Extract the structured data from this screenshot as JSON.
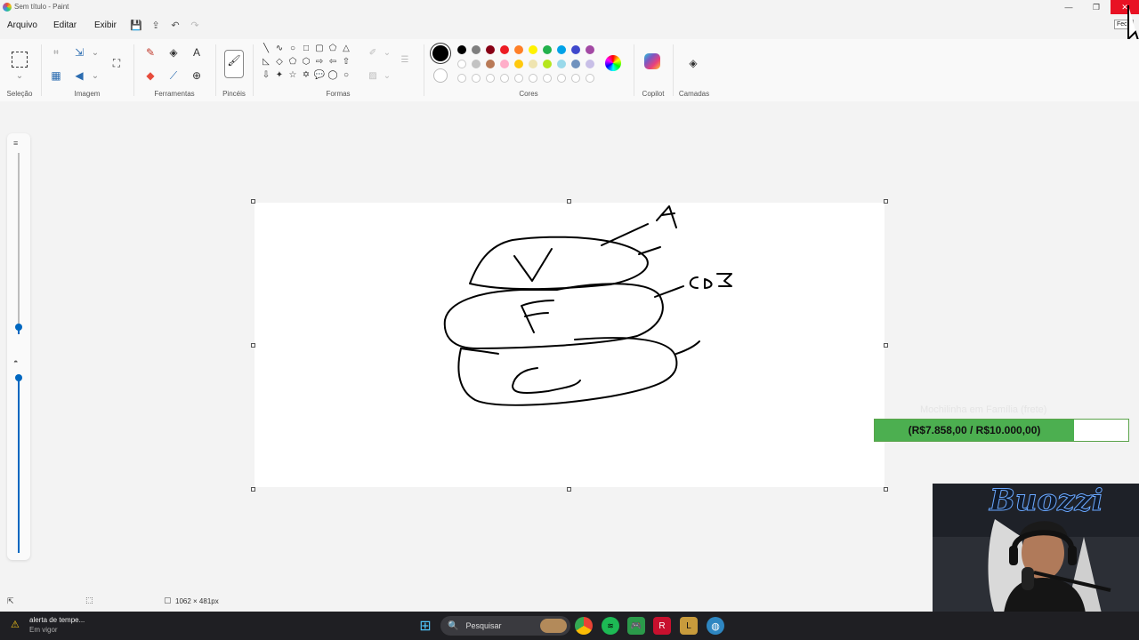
{
  "window": {
    "title": "Sem título - Paint",
    "minimize_icon": "minimize-icon",
    "restore_icon": "restore-icon",
    "close_icon": "close-icon",
    "close_tooltip": "Fech"
  },
  "menu": [
    "Arquivo",
    "Editar",
    "Exibir"
  ],
  "ribbon": {
    "groups": [
      "Seleção",
      "Imagem",
      "Ferramentas",
      "Pincéis",
      "Formas",
      "Cores",
      "Copilot",
      "Camadas"
    ],
    "colors_row1": [
      "#000000",
      "#7f7f7f",
      "#880015",
      "#ed1c24",
      "#ff7f27",
      "#fff200",
      "#22b14c",
      "#00a2e8",
      "#3f48cc",
      "#a349a4"
    ],
    "colors_row2": [
      "",
      "#c3c3c3",
      "#b97a57",
      "#ffaec9",
      "#ffc90e",
      "#efe4b0",
      "#b5e61d",
      "#99d9ea",
      "#7092be",
      "#c8bfe7"
    ],
    "colors_row3": [
      "",
      "",
      "",
      "",
      "",
      "",
      "",
      "",
      "",
      ""
    ],
    "primary_color": "#000000",
    "secondary_color": "#ffffff"
  },
  "drawing": {
    "labels": [
      "A",
      "CD'B",
      "V",
      "F",
      "C"
    ]
  },
  "status": {
    "canvas_size": "1062 × 481px"
  },
  "overlay": {
    "goal_title": "Mochilinha em Família (frete)",
    "goal_text": "(R$7.858,00 / R$10.000,00)",
    "current": 7858,
    "target": 10000,
    "fill_color": "#4caf50"
  },
  "taskbar": {
    "alert_title": "alerta de tempe...",
    "alert_sub": "Em vigor",
    "search_placeholder": "Pesquisar",
    "apps": [
      "windows-start-icon",
      "chrome-icon",
      "spotify-icon",
      "xbox-icon",
      "riot-icon",
      "league-icon",
      "globe-icon"
    ]
  }
}
